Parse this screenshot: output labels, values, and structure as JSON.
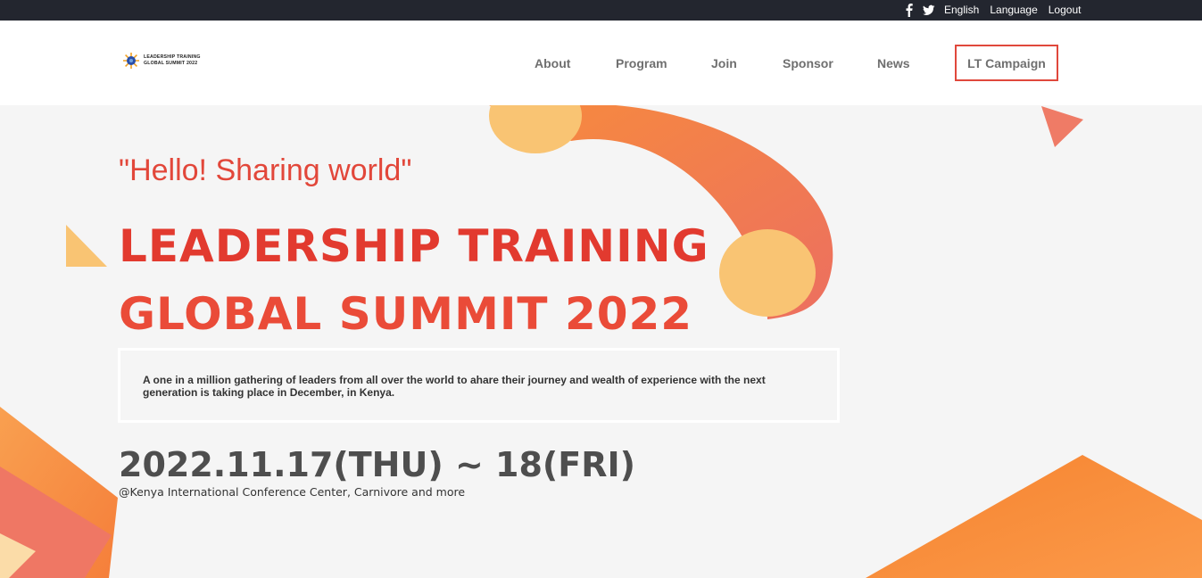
{
  "topbar": {
    "social_icons": [
      "facebook-icon",
      "twitter-icon"
    ],
    "links": [
      "English",
      "Language",
      "Logout"
    ]
  },
  "header": {
    "logo": {
      "line1": "LEADERSHIP TRAINING",
      "line2": "GLOBAL SUMMIT 2022"
    },
    "nav": [
      "About",
      "Program",
      "Join",
      "Sponsor",
      "News"
    ],
    "campaign": "LT Campaign"
  },
  "hero": {
    "greeting": "\"Hello! Sharing world\"",
    "title_line1": "LEADERSHIP TRAINING",
    "title_line2": "GLOBAL SUMMIT 2022",
    "description": "A one in a million gathering of leaders from all over the world to ahare their journey and wealth of experience with the next generation is taking place in December, in Kenya.",
    "date": "2022.11.17(THU) ~ 18(FRI)",
    "venue": "@Kenya International Conference Center, Carnivore and more"
  },
  "colors": {
    "accent_red": "#e23a2f",
    "accent_orange": "#f8893a",
    "accent_yellow": "#f8c471",
    "accent_coral": "#ee7b68",
    "topbar_bg": "#23262f"
  }
}
